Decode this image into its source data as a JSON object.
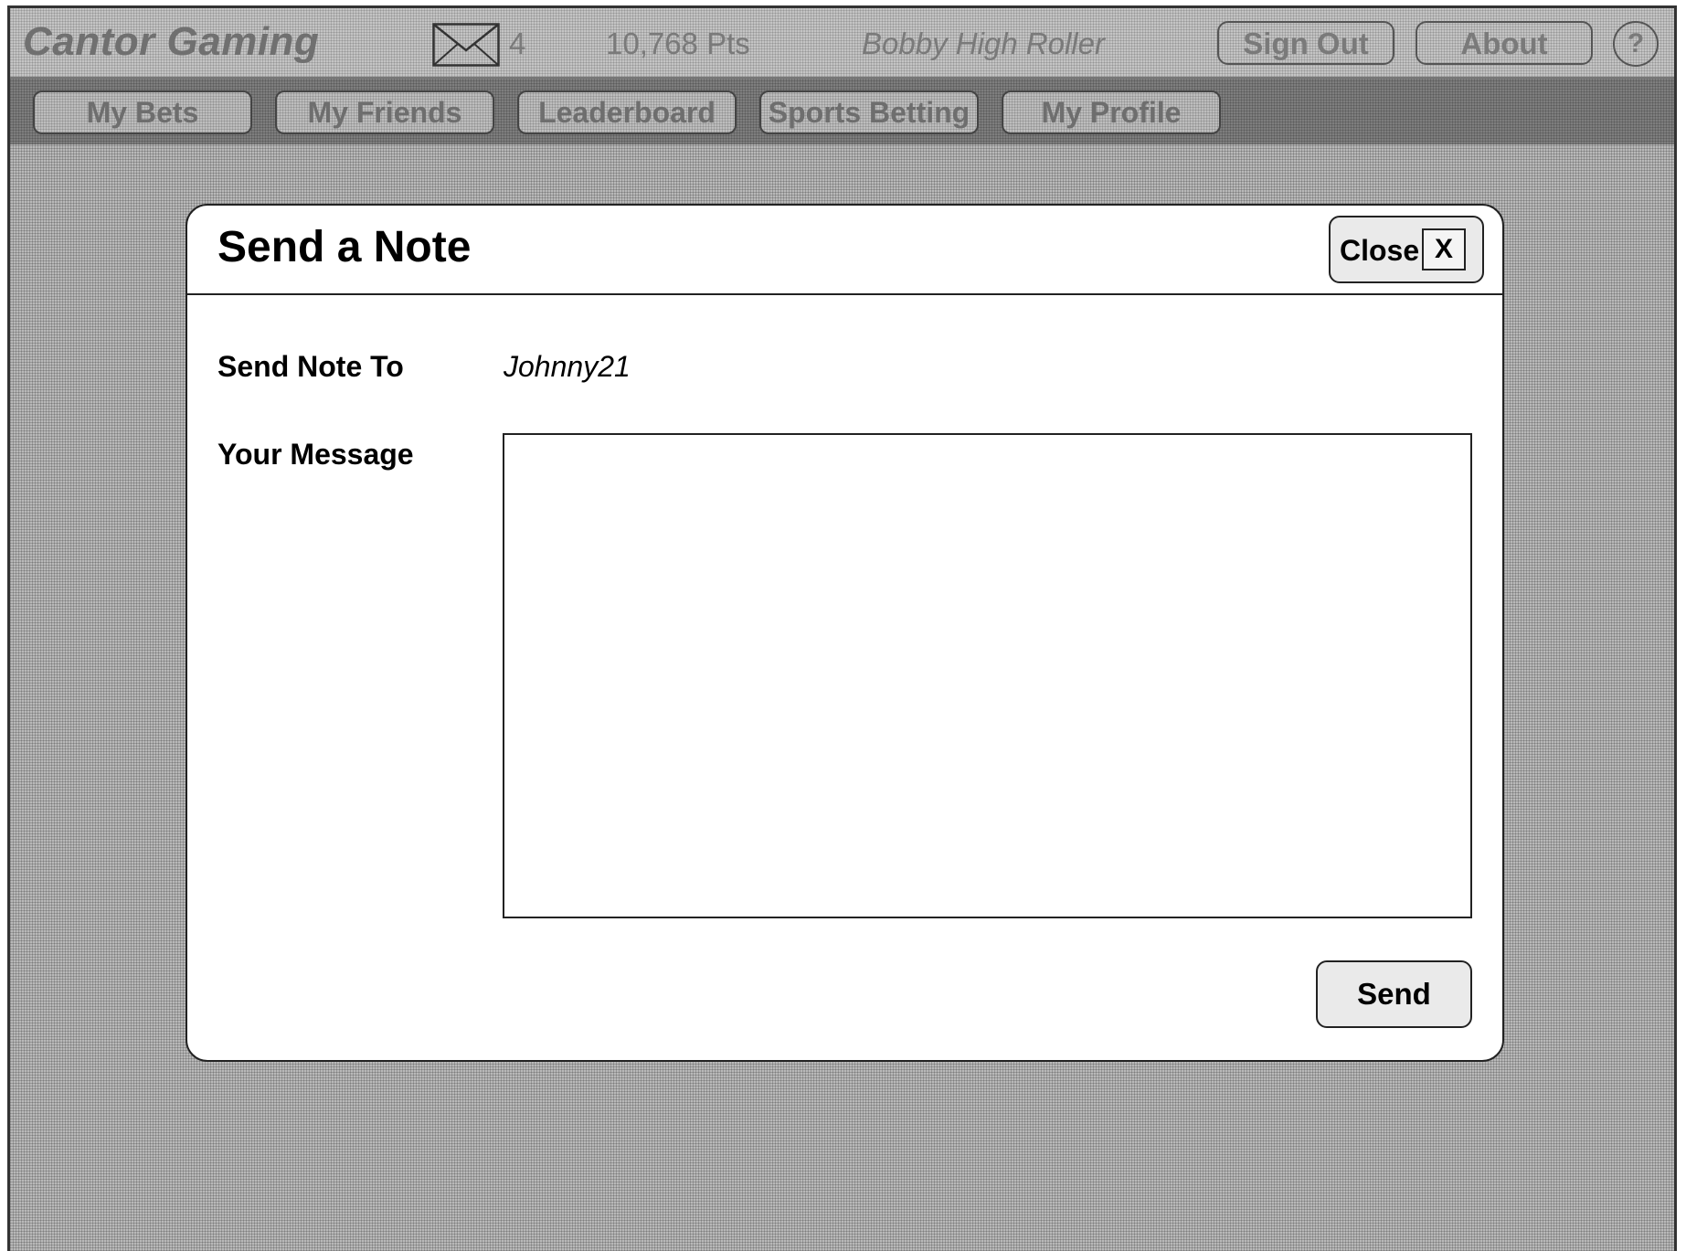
{
  "header": {
    "brand": "Cantor Gaming",
    "mail_count": "4",
    "points": "10,768 Pts",
    "username": "Bobby High Roller",
    "sign_out_label": "Sign Out",
    "about_label": "About",
    "help_label": "?"
  },
  "nav": {
    "tabs": [
      {
        "label": "My Bets"
      },
      {
        "label": "My Friends"
      },
      {
        "label": "Leaderboard"
      },
      {
        "label": "Sports Betting"
      },
      {
        "label": "My Profile"
      }
    ]
  },
  "modal": {
    "title": "Send a Note",
    "close_label": "Close",
    "close_x": "X",
    "to_label": "Send Note To",
    "to_value": "Johnny21",
    "message_label": "Your Message",
    "message_value": "",
    "send_label": "Send"
  },
  "icons": {
    "mail": "envelope-icon",
    "help": "help-icon"
  }
}
